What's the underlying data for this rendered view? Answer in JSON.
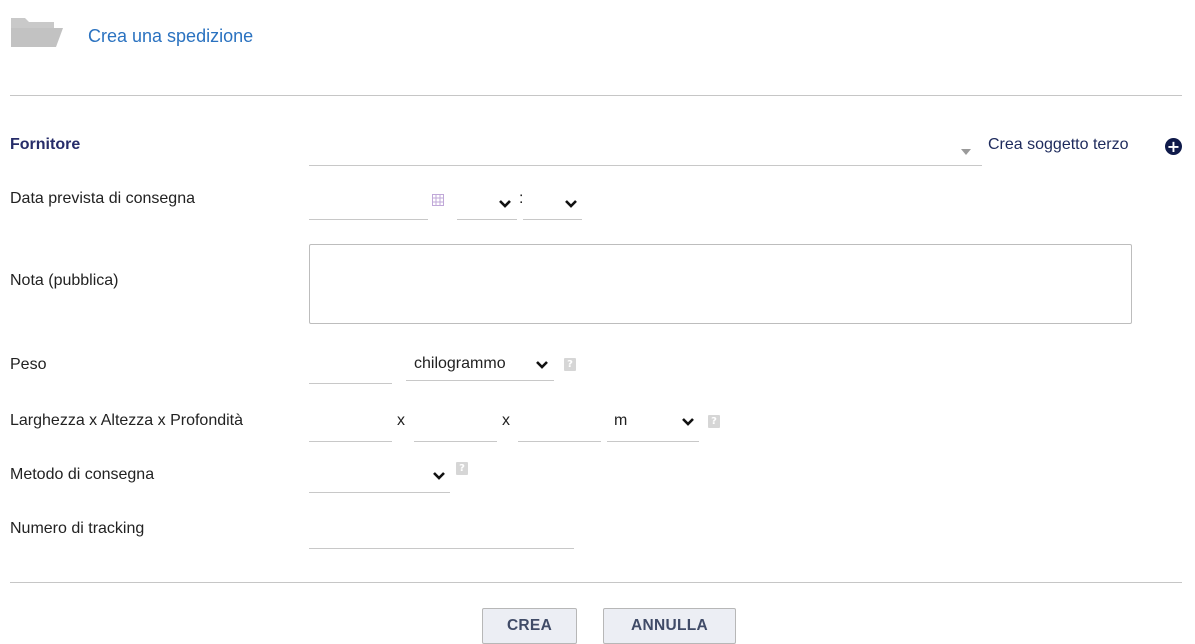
{
  "header": {
    "title": "Crea una spedizione",
    "icon": "folder-icon"
  },
  "form": {
    "supplier": {
      "label": "Fornitore",
      "value": "",
      "create_link": "Crea soggetto terzo"
    },
    "delivery_date": {
      "label": "Data prevista di consegna",
      "date_value": "",
      "hour_value": "",
      "minute_value": "",
      "time_separator": ":"
    },
    "note": {
      "label": "Nota (pubblica)",
      "value": ""
    },
    "weight": {
      "label": "Peso",
      "value": "",
      "unit": "chilogrammo"
    },
    "dimensions": {
      "label": "Larghezza x Altezza x Profondità",
      "width": "",
      "height": "",
      "depth": "",
      "separator": "x",
      "unit": "m"
    },
    "shipping_method": {
      "label": "Metodo di consegna",
      "value": ""
    },
    "tracking": {
      "label": "Numero di tracking",
      "value": ""
    }
  },
  "actions": {
    "create_label": "CREA",
    "cancel_label": "ANNULLA"
  },
  "colors": {
    "title": "#2a72c0",
    "field_label_bold": "#262c69",
    "button_bg": "#eceef4",
    "separator": "#c6c6c6"
  }
}
